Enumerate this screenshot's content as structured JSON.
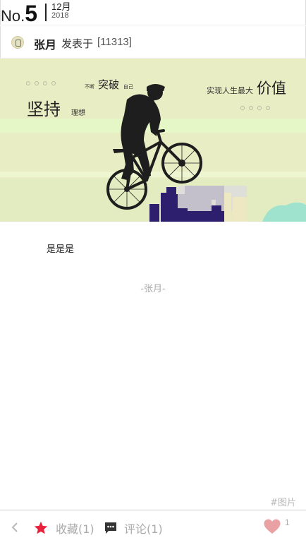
{
  "header": {
    "issue_prefix": "No.",
    "issue_number": "5",
    "month": "12月",
    "year": "2018"
  },
  "author": {
    "name": "张月",
    "posted_label": "发表于",
    "post_id": "[11313]"
  },
  "banner": {
    "word_small_1": "不断",
    "word_break": "突破",
    "word_small_2": "自己",
    "word_persist": "坚持",
    "word_ideal": "理想",
    "word_realize": "实现人生最大",
    "word_value": "价值",
    "colors": {
      "background": "#e8edc4",
      "band": "#e4f7c8",
      "silhouette": "#1e1e1e",
      "building": "#2e1f6e",
      "accent": "#9fe3cf"
    }
  },
  "content": {
    "text": "是是是",
    "signature": "-张月-"
  },
  "footer": {
    "tag": "#图片",
    "favorite_label": "收藏(1)",
    "comment_label": "评论(1)",
    "like_count": "1",
    "icons": [
      "chevron-left-icon",
      "star-icon",
      "comment-icon",
      "heart-icon"
    ],
    "colors": {
      "star": "#e8223a",
      "heart": "#e9a1a3",
      "comment": "#333333"
    }
  }
}
